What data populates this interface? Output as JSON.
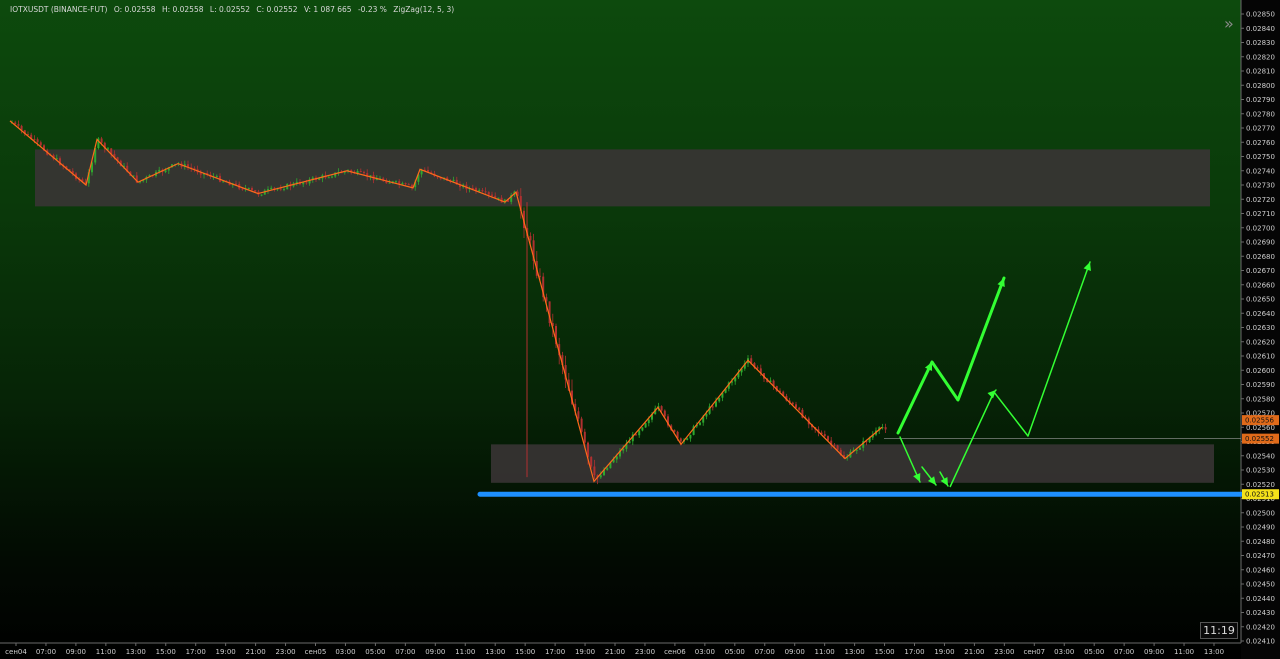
{
  "header": {
    "symbol": "IOTXUSDT (BINANCE-FUT)",
    "open": "O: 0.02558",
    "high": "H: 0.02558",
    "low": "L: 0.02552",
    "close": "C: 0.02552",
    "volume": "V: 1 087 665",
    "change": "-0.23 %",
    "indicator": "ZigZag(12, 5, 3)"
  },
  "clock": "11:19",
  "price_tags": {
    "upper": "0.02556",
    "current": "0.02552",
    "support": "0.02513"
  },
  "colors": {
    "background_top": "#0d4a0d",
    "candle_up": "#2fa82f",
    "candle_down": "#b03030",
    "zigzag": "#ff6a1a",
    "zone": "#3a3436",
    "support_line": "#1e90ff",
    "projection_arrows": "#33ff33"
  },
  "chart_data": {
    "type": "candlestick",
    "y_ticks": [
      "0.02850",
      "0.02840",
      "0.02830",
      "0.02820",
      "0.02810",
      "0.02800",
      "0.02790",
      "0.02780",
      "0.02770",
      "0.02760",
      "0.02750",
      "0.02740",
      "0.02730",
      "0.02720",
      "0.02710",
      "0.02700",
      "0.02690",
      "0.02680",
      "0.02670",
      "0.02660",
      "0.02650",
      "0.02640",
      "0.02630",
      "0.02620",
      "0.02610",
      "0.02600",
      "0.02590",
      "0.02580",
      "0.02570",
      "0.02560",
      "0.02550",
      "0.02540",
      "0.02530",
      "0.02520",
      "0.02510",
      "0.02500",
      "0.02490",
      "0.02480",
      "0.02470",
      "0.02460",
      "0.02450",
      "0.02440",
      "0.02430",
      "0.02420",
      "0.02410"
    ],
    "x_ticks": [
      "сен04",
      "07:00",
      "09:00",
      "11:00",
      "13:00",
      "15:00",
      "17:00",
      "19:00",
      "21:00",
      "23:00",
      "сен05",
      "03:00",
      "05:00",
      "07:00",
      "09:00",
      "11:00",
      "13:00",
      "15:00",
      "17:00",
      "19:00",
      "21:00",
      "23:00",
      "сен06",
      "03:00",
      "05:00",
      "07:00",
      "09:00",
      "11:00",
      "13:00",
      "15:00",
      "17:00",
      "19:00",
      "21:00",
      "23:00",
      "сен07",
      "03:00",
      "05:00",
      "07:00",
      "09:00",
      "11:00",
      "13:00"
    ],
    "zigzag": [
      0.02775,
      0.0273,
      0.02762,
      0.02732,
      0.02745,
      0.02724,
      0.0274,
      0.02728,
      0.02741,
      0.02718,
      0.02725,
      0.02522,
      0.02574,
      0.02548,
      0.02607,
      0.02538,
      0.0256
    ],
    "zones": [
      {
        "from": 0.02715,
        "to": 0.02755
      },
      {
        "from": 0.02521,
        "to": 0.02548
      }
    ],
    "support_level": 0.02513,
    "current_price": 0.02552
  }
}
